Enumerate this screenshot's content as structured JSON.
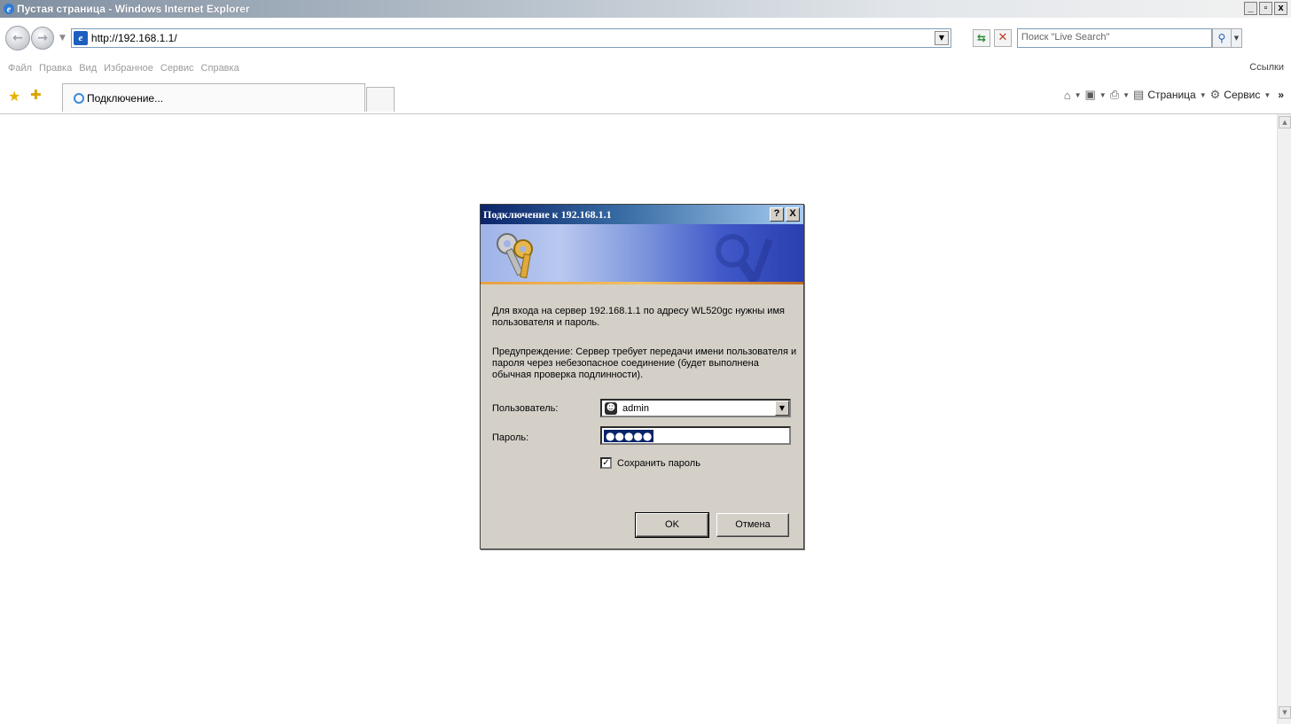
{
  "window": {
    "title": "Пустая страница - Windows Internet Explorer",
    "controls": [
      "_",
      "▫",
      "x"
    ]
  },
  "address": {
    "url": "http://192.168.1.1/",
    "search_placeholder": "Поиск \"Live Search\""
  },
  "menu": {
    "items": [
      "Файл",
      "Правка",
      "Вид",
      "Избранное",
      "Сервис",
      "Справка"
    ],
    "links_label": "Ссылки"
  },
  "tab": {
    "label": "Подключение..."
  },
  "command_bar": {
    "page_label": "Страница",
    "tools_label": "Сервис"
  },
  "dialog": {
    "title": "Подключение к 192.168.1.1",
    "help_button": "?",
    "close_button": "X",
    "message": "Для входа на сервер 192.168.1.1 по адресу WL520gc нужны имя пользователя и пароль.",
    "warning": "Предупреждение: Сервер требует передачи имени пользователя и пароля через небезопасное соединение (будет выполнена обычная проверка подлинности).",
    "user_label": "Пользователь:",
    "user_value": "admin",
    "password_label": "Пароль:",
    "password_mask": "●●●●●",
    "remember_checked": true,
    "remember_label": "Сохранить пароль",
    "ok_label": "OK",
    "cancel_label": "Отмена"
  }
}
